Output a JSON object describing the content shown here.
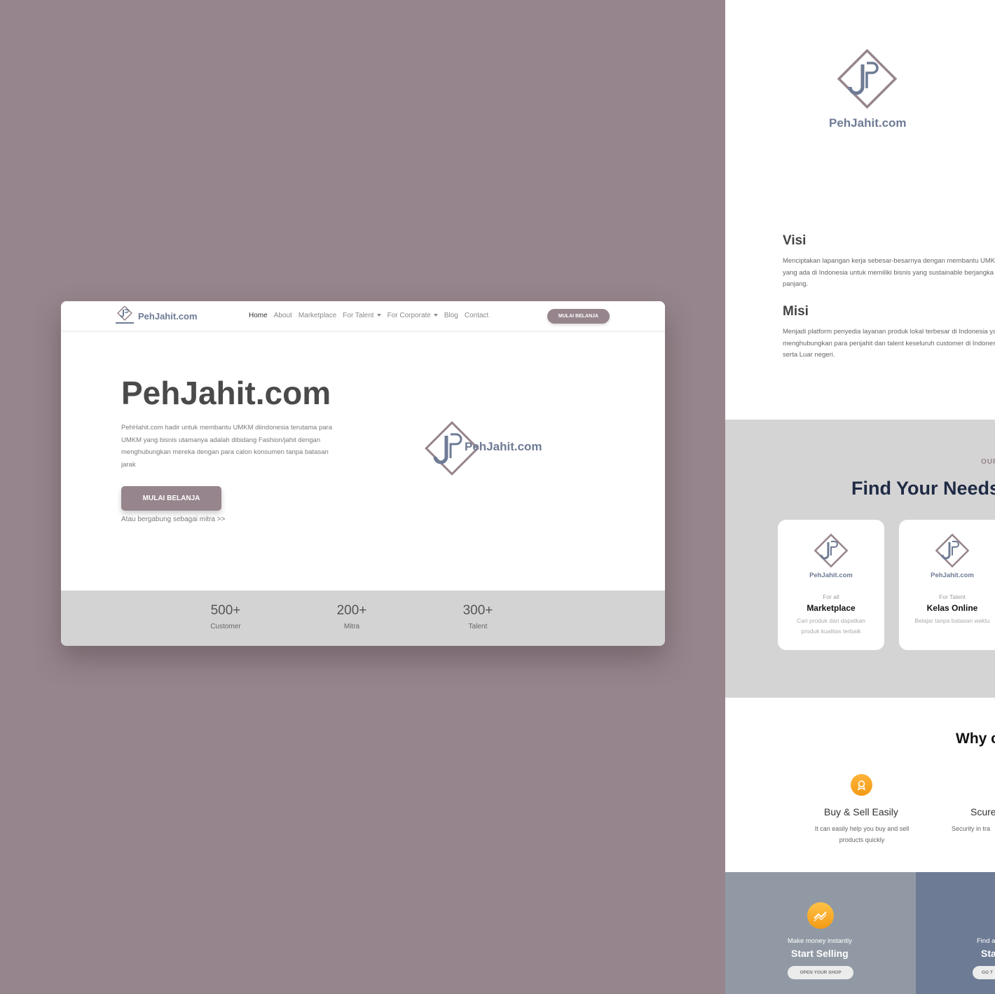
{
  "colors": {
    "background": "#96858c",
    "accent": "#96858c",
    "brand_text": "#6e7b95",
    "stats_band": "#d3d3d3",
    "orange_icon": "#f5a623"
  },
  "mockup": {
    "nav": {
      "brand": "PehJahit.com",
      "items": [
        "Home",
        "About",
        "Marketplace",
        "For Talent",
        "For Corporate",
        "Blog",
        "Contact"
      ],
      "cta": "MULAI BELANJA"
    },
    "hero": {
      "title": "PehJahit.com",
      "description": "PehHahit.com hadir untuk membantu UMKM diindonesia terutama para UMKM yang bisnis utamanya adalah dibidang Fashion/jahit dengan menghubungkan mereka dengan para calon konsumen tanpa batasan jarak",
      "button": "MULAI BELANJA",
      "link": "Atau bergabung sebagai mitra >>",
      "logo_text": "PehJahit.com"
    },
    "stats": [
      {
        "value": "500+",
        "label": "Customer"
      },
      {
        "value": "200+",
        "label": "Mitra"
      },
      {
        "value": "300+",
        "label": "Talent"
      }
    ]
  },
  "page": {
    "logo_text": "PehJahit.com",
    "visi": {
      "title": "Visi",
      "text": "Menciptakan lapangan kerja sebesar-besarnya dengan membantu UMKM yang ada di Indonesia untuk memiliki bisnis yang sustainable berjangka panjang."
    },
    "misi": {
      "title": "Misi",
      "text": "Menjadi platform penyedia layanan produk lokal terbesar di Indonesia yang menghubungkan para penjahit dan talent keseluruh customer di Indonesia serta Luar negeri."
    },
    "needs": {
      "eyebrow": "OUR",
      "title": "Find Your Needs",
      "cards": [
        {
          "brand": "PehJahit.com",
          "sub": "For all",
          "name": "Marketplace",
          "desc": "Cari produk dan dapatkan produk kualitas terbaik"
        },
        {
          "brand": "PehJahit.com",
          "sub": "For Talent",
          "name": "Kelas Online",
          "desc": "Belajar tanpa batasan waktu"
        }
      ]
    },
    "why": {
      "title": "Why c",
      "features": [
        {
          "title": "Buy & Sell Easily",
          "desc": "It can easily help you buy and sell products quickly",
          "icon": "award-icon"
        },
        {
          "title": "Scure",
          "desc": "Security in tra",
          "icon": "shield-icon"
        }
      ]
    },
    "sell": {
      "small": "Make money instantly",
      "big": "Start Selling",
      "button": "OPEN YOUR SHOP",
      "small2": "Find a",
      "big2": "Sta",
      "button2": "GO T"
    }
  }
}
